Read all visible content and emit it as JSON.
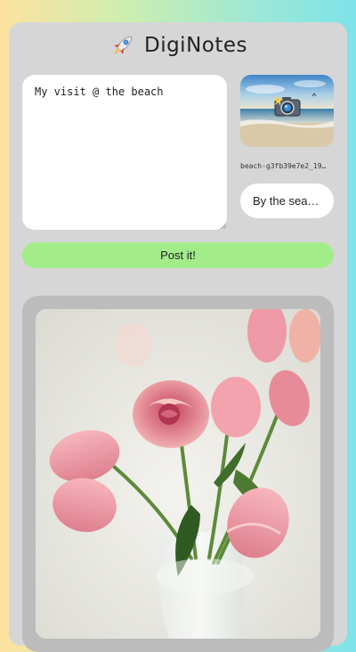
{
  "app": {
    "title": "DigiNotes",
    "logo_icon": "rocket-icon"
  },
  "composer": {
    "text_value": "My visit @ the beach",
    "image_icon": "camera-icon",
    "image_filename": "beach-g3fb39e7e2_19…",
    "caption_value": "By the sea…",
    "post_label": "Post it!"
  },
  "feed": {
    "post_image_subject": "pink-roses-and-tulips-photo"
  },
  "colors": {
    "card_bg": "#d6d6d6",
    "post_button_bg": "#a3ec8a",
    "post_frame_bg": "#bcbcbc"
  }
}
